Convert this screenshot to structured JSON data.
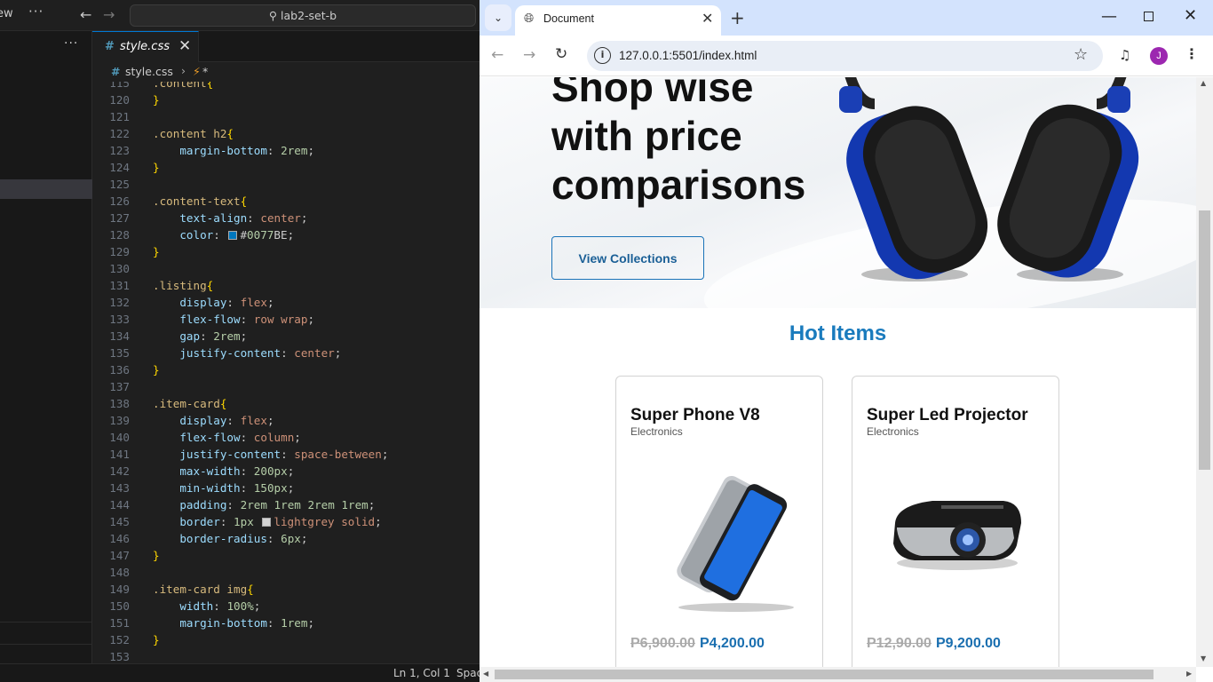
{
  "vscode": {
    "menu_label": "ew",
    "more_label": "···",
    "search_label": "lab2-set-b",
    "side_more": "···",
    "tab": {
      "icon": "#",
      "name": "style.css",
      "close": "✕"
    },
    "breadcrumb": {
      "icon": "#",
      "file": "style.css",
      "sep": "›",
      "symbol": "⚡",
      "star": "*"
    },
    "status": {
      "position": "Ln 1, Col 1",
      "spaces": "Spac"
    },
    "lines": [
      {
        "n": "115",
        "code": ".content{"
      },
      {
        "n": "120",
        "code": "}"
      },
      {
        "n": "121",
        "code": ""
      },
      {
        "n": "122",
        "code": ".content h2{"
      },
      {
        "n": "123",
        "code": "    margin-bottom: 2rem;"
      },
      {
        "n": "124",
        "code": "}"
      },
      {
        "n": "125",
        "code": ""
      },
      {
        "n": "126",
        "code": ".content-text{"
      },
      {
        "n": "127",
        "code": "    text-align: center;"
      },
      {
        "n": "128",
        "code": "    color: #0077BE;"
      },
      {
        "n": "129",
        "code": "}"
      },
      {
        "n": "130",
        "code": ""
      },
      {
        "n": "131",
        "code": ".listing{"
      },
      {
        "n": "132",
        "code": "    display: flex;"
      },
      {
        "n": "133",
        "code": "    flex-flow: row wrap;"
      },
      {
        "n": "134",
        "code": "    gap: 2rem;"
      },
      {
        "n": "135",
        "code": "    justify-content: center;"
      },
      {
        "n": "136",
        "code": "}"
      },
      {
        "n": "137",
        "code": ""
      },
      {
        "n": "138",
        "code": ".item-card{"
      },
      {
        "n": "139",
        "code": "    display: flex;"
      },
      {
        "n": "140",
        "code": "    flex-flow: column;"
      },
      {
        "n": "141",
        "code": "    justify-content: space-between;"
      },
      {
        "n": "142",
        "code": "    max-width: 200px;"
      },
      {
        "n": "143",
        "code": "    min-width: 150px;"
      },
      {
        "n": "144",
        "code": "    padding: 2rem 1rem 2rem 1rem;"
      },
      {
        "n": "145",
        "code": "    border: 1px lightgrey solid;"
      },
      {
        "n": "146",
        "code": "    border-radius: 6px;"
      },
      {
        "n": "147",
        "code": "}"
      },
      {
        "n": "148",
        "code": ""
      },
      {
        "n": "149",
        "code": ".item-card img{"
      },
      {
        "n": "150",
        "code": "    width: 100%;"
      },
      {
        "n": "151",
        "code": "    margin-bottom: 1rem;"
      },
      {
        "n": "152",
        "code": "}"
      },
      {
        "n": "153",
        "code": ""
      }
    ]
  },
  "browser": {
    "tab_title": "Document",
    "tab_close": "✕",
    "new_tab": "+",
    "url": "127.0.0.1:5501/index.html",
    "avatar_initial": "J",
    "window_controls": {
      "min": "—",
      "close": "✕"
    }
  },
  "page": {
    "hero_title": "Shop wise with price comparisons",
    "hero_button": "View Collections",
    "section_title": "Hot Items",
    "items": [
      {
        "name": "Super Phone V8",
        "category": "Electronics",
        "old_price": "P6,900.00",
        "price": "P4,200.00"
      },
      {
        "name": "Super Led Projector",
        "category": "Electronics",
        "old_price": "P12,90.00",
        "price": "P9,200.00"
      }
    ]
  },
  "colors": {
    "accent": "#1a7bbd",
    "vscode_bg": "#1f1f1f",
    "chrome_tabstrip": "#d3e3fd"
  },
  "icons": [
    "search-icon",
    "back-arrow-icon",
    "forward-arrow-icon",
    "close-icon",
    "globe-icon",
    "reload-icon",
    "info-icon",
    "star-icon",
    "media-icon",
    "kebab-menu-icon"
  ]
}
